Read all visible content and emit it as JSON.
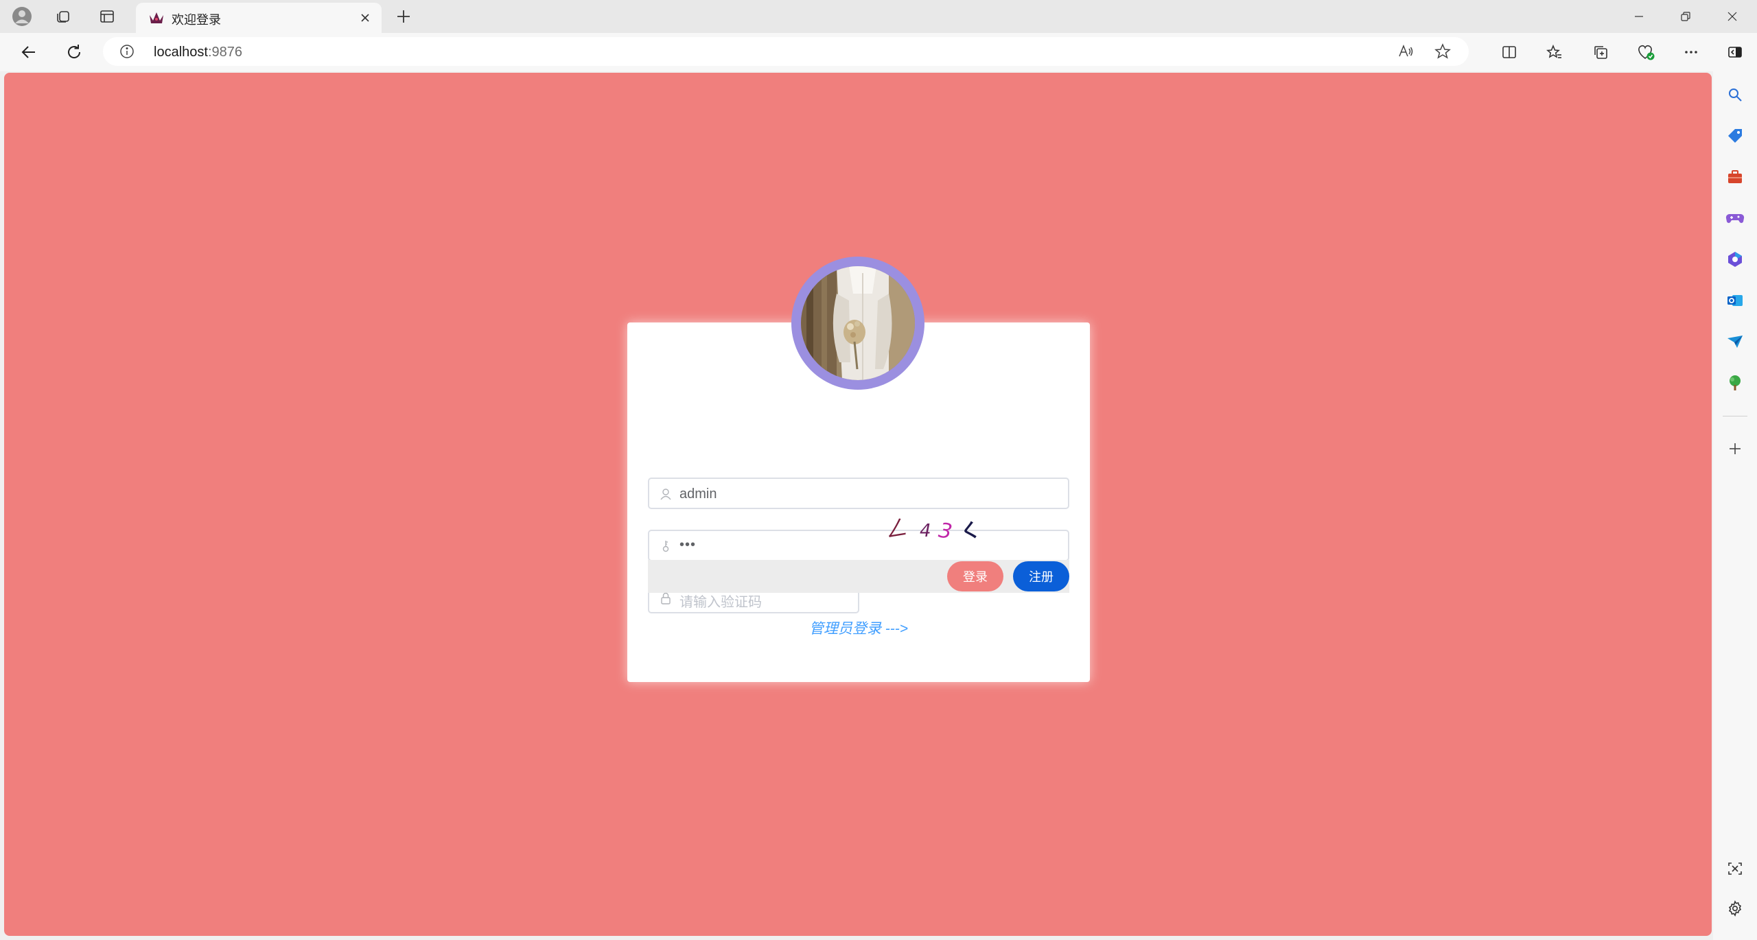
{
  "browser": {
    "tab_title": "欢迎登录",
    "url_host": "localhost",
    "url_port": ":9876"
  },
  "login": {
    "username_value": "admin",
    "password_mask": "•••",
    "captcha_placeholder": "请输入验证码",
    "captcha_chars": [
      "ㄥ",
      "4",
      "3",
      "く"
    ],
    "captcha_colors": [
      "#7a1f3d",
      "#6b2060",
      "#c026a8",
      "#1a1a4a"
    ],
    "login_button": "登录",
    "register_button": "注册",
    "admin_link": "管理员登录 --->"
  },
  "colors": {
    "page_background": "#f07f7d",
    "avatar_ring": "#9b8fe0",
    "login_button": "#f07f7d",
    "register_button": "#0b5fd8",
    "link": "#409eff"
  }
}
